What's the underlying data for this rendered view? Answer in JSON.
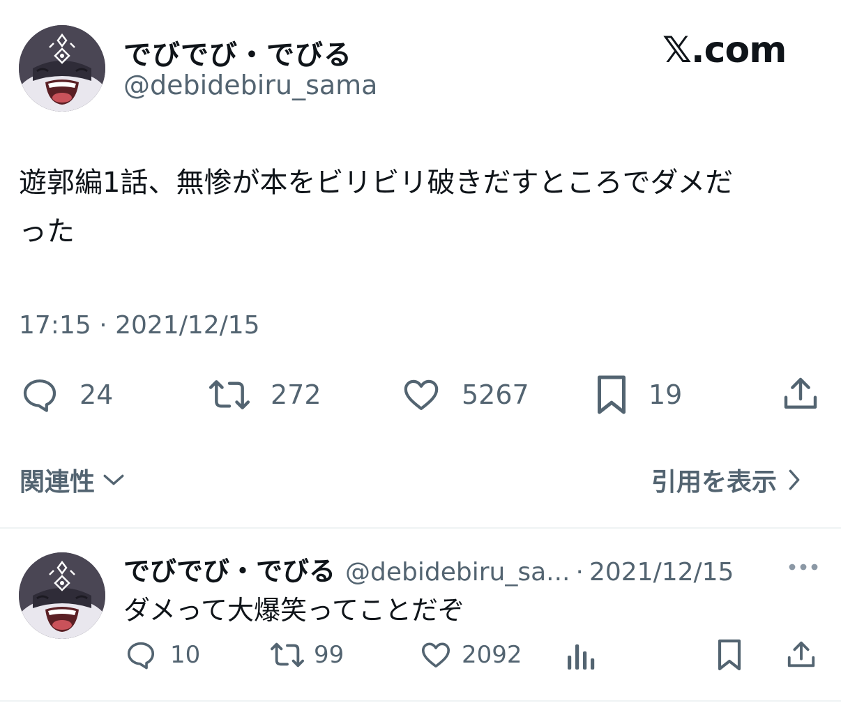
{
  "brand": "𝕏.com",
  "tweet": {
    "display_name": "でびでび・でびる",
    "handle": "@debidebiru_sama",
    "text_line1": "遊郭編1話、無惨が本をビリビリ破きだすところでダメだ",
    "text_line2": "った",
    "timestamp": "17:15 · 2021/12/15",
    "stats": {
      "replies": "24",
      "retweets": "272",
      "likes": "5267",
      "bookmarks": "19"
    },
    "relevance_label": "関連性",
    "view_quotes_label": "引用を表示"
  },
  "reply": {
    "display_name": "でびでび・でびる",
    "handle": "@debidebiru_sa...",
    "separator": "·",
    "date": "2021/12/15",
    "text": "ダメって大爆笑ってことだぞ",
    "stats": {
      "replies": "10",
      "retweets": "99",
      "likes": "2092"
    }
  },
  "icons": {
    "reply": "speech-bubble-icon",
    "retweet": "retweet-icon",
    "like": "heart-icon",
    "bookmark": "bookmark-icon",
    "share": "share-upload-icon",
    "views": "bar-chart-icon",
    "more": "more-dots-icon"
  },
  "colors": {
    "text": "#0f1419",
    "secondary": "#536471",
    "divider": "#eff3f4"
  }
}
